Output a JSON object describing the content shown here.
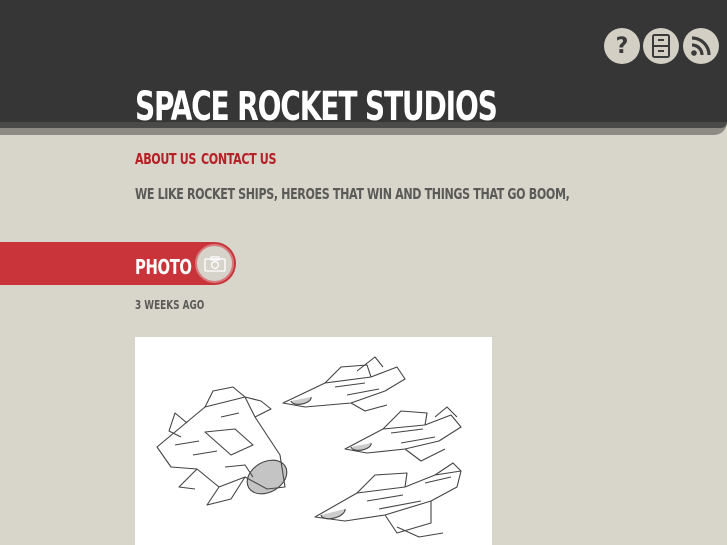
{
  "header": {
    "title": "SPACE ROCKET STUDIOS",
    "icons": [
      "help-icon",
      "archive-icon",
      "rss-icon"
    ],
    "help_glyph": "?"
  },
  "nav": {
    "about": "ABOUT US",
    "contact": "CONTACT US"
  },
  "tagline": "WE LIKE ROCKET SHIPS, HEROES THAT WIN AND THINGS THAT GO BOOM,",
  "post": {
    "type": "PHOTO",
    "icon": "camera-icon",
    "timestamp": "3 WEEKS AGO",
    "image": "spaceship-sketches"
  },
  "colors": {
    "header_bg": "#363636",
    "page_bg": "#d8d5ca",
    "accent_red": "#b62025",
    "banner_red": "#c8343a"
  }
}
